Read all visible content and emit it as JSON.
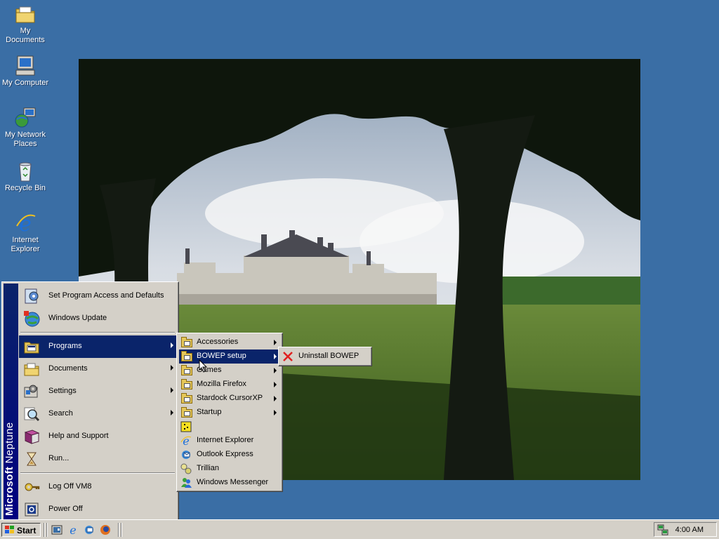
{
  "desktop": {
    "icons": [
      {
        "label_lines": [
          "My Documents"
        ]
      },
      {
        "label_lines": [
          "My Computer"
        ]
      },
      {
        "label_lines": [
          "My Network",
          "Places"
        ]
      },
      {
        "label_lines": [
          "Recycle Bin"
        ]
      },
      {
        "label_lines": [
          "Internet",
          "Explorer"
        ]
      }
    ]
  },
  "start_menu": {
    "banner_bold": "Microsoft",
    "banner_light": " Neptune",
    "items": [
      {
        "label": "Set Program Access and Defaults"
      },
      {
        "label": "Windows Update"
      },
      {
        "label": "Programs"
      },
      {
        "label": "Documents"
      },
      {
        "label": "Settings"
      },
      {
        "label": "Search"
      },
      {
        "label": "Help and Support"
      },
      {
        "label": "Run..."
      },
      {
        "label": "Log Off VM8"
      },
      {
        "label": "Power Off"
      }
    ]
  },
  "programs_menu": {
    "items": [
      {
        "label": "Accessories"
      },
      {
        "label": "BOWEP setup"
      },
      {
        "label": "Games"
      },
      {
        "label": "Mozilla Firefox"
      },
      {
        "label": "Stardock CursorXP"
      },
      {
        "label": "Startup"
      },
      {
        "label": ""
      },
      {
        "label": "Internet Explorer"
      },
      {
        "label": "Outlook Express"
      },
      {
        "label": "Trillian"
      },
      {
        "label": "Windows Messenger"
      }
    ]
  },
  "bowep_menu": {
    "items": [
      {
        "label": "Uninstall BOWEP"
      }
    ]
  },
  "taskbar": {
    "start_label": "Start",
    "clock": "4:00 AM"
  },
  "colors": {
    "desktop": "#3a6ea5",
    "menu_face": "#d4d0c8",
    "highlight": "#0a246a"
  }
}
